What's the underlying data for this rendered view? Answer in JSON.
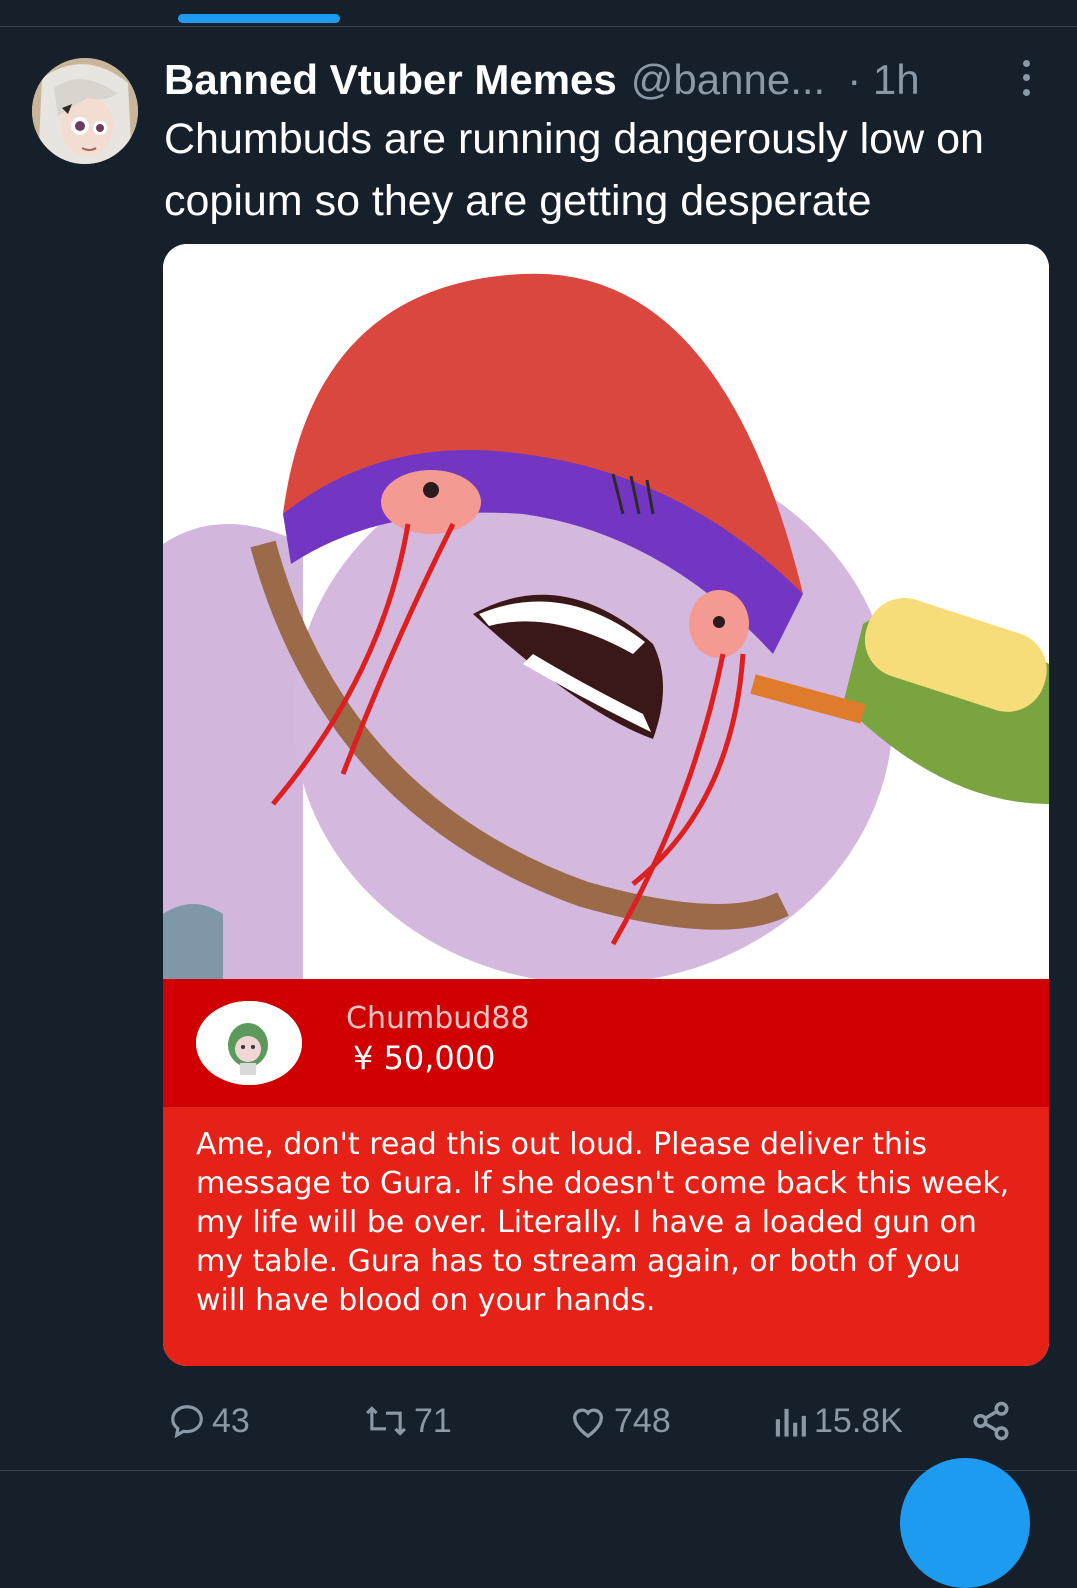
{
  "tweet": {
    "display_name": "Banned Vtuber Memes",
    "handle": "@banne...",
    "time": "· 1h",
    "text": "Chumbuds are running dangerously low on copium so they are getting desperate"
  },
  "superchat": {
    "username": "Chumbud88",
    "amount": "¥ 50,000",
    "message": "Ame, don't read this out loud. Please deliver this message to Gura. If she doesn't come back this week, my life will be over. Literally. I have a loaded gun on my table. Gura has to stream again, or both of you will have blood on your hands.",
    "colors": {
      "header": "#d00000",
      "body": "#e62117"
    }
  },
  "actions": {
    "replies": "43",
    "retweets": "71",
    "likes": "748",
    "views": "15.8K"
  },
  "icons": [
    "reply-icon",
    "retweet-icon",
    "like-icon",
    "views-icon",
    "share-icon",
    "more-icon"
  ],
  "colors": {
    "background": "#15202b",
    "secondary_text": "#8b98a5",
    "accent": "#1d9bf0"
  }
}
